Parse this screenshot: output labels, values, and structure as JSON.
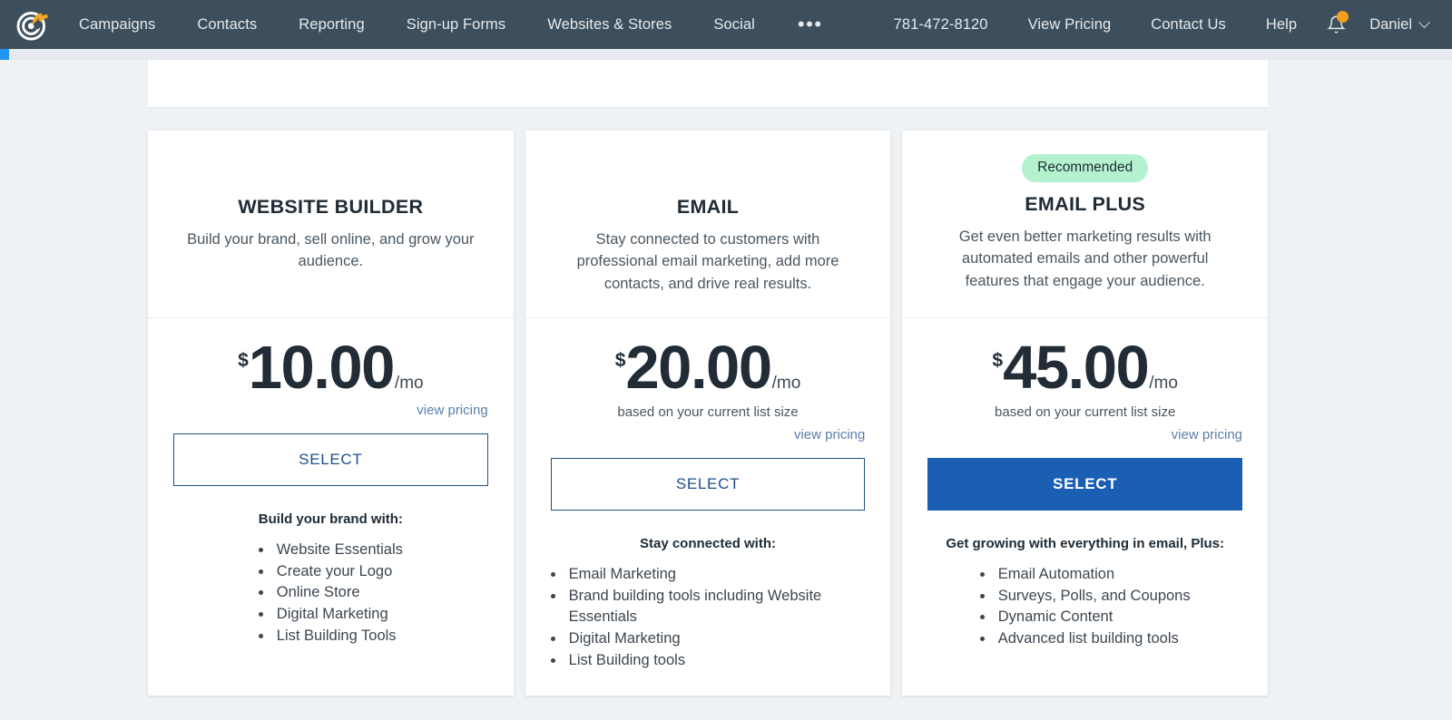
{
  "navbar": {
    "logo_icon": "constant-contact-spiral-logo",
    "left_links": [
      {
        "label": "Campaigns"
      },
      {
        "label": "Contacts"
      },
      {
        "label": "Reporting"
      },
      {
        "label": "Sign-up Forms"
      },
      {
        "label": "Websites & Stores"
      },
      {
        "label": "Social"
      }
    ],
    "overflow_label": "•••",
    "right_links": [
      {
        "label": "781-472-8120"
      },
      {
        "label": "View Pricing"
      },
      {
        "label": "Contact Us"
      },
      {
        "label": "Help"
      }
    ],
    "bell_icon": "notification-bell-icon",
    "has_notification": true,
    "user_name": "Daniel",
    "chevron_icon": "chevron-down-icon",
    "background_color": "#3d4f5c",
    "notification_color": "#f8a01c"
  },
  "progress": {
    "segment_color": "#2196f3",
    "track_color": "#e6eaee"
  },
  "plans": [
    {
      "badge": "",
      "name": "WEBSITE BUILDER",
      "description": "Build your brand, sell online, and grow your audience.",
      "currency": "$",
      "amount": "10.00",
      "period": "/mo",
      "list_note": "",
      "view_pricing": "view pricing",
      "select_label": "SELECT",
      "select_style": "outline",
      "features_title": "Build your brand with:",
      "features": [
        "Website Essentials",
        "Create your Logo",
        "Online Store",
        "Digital Marketing",
        "List Building Tools"
      ]
    },
    {
      "badge": "",
      "name": "EMAIL",
      "description": "Stay connected to customers with professional email marketing, add more contacts, and drive real results.",
      "currency": "$",
      "amount": "20.00",
      "period": "/mo",
      "list_note": "based on your current list size",
      "view_pricing": "view pricing",
      "select_label": "SELECT",
      "select_style": "outline",
      "features_title": "Stay connected with:",
      "features": [
        "Email Marketing",
        "Brand building tools including Website Essentials",
        "Digital Marketing",
        "List Building tools"
      ]
    },
    {
      "badge": "Recommended",
      "name": "EMAIL PLUS",
      "description": "Get even better marketing results with automated emails and other powerful features that engage your audience.",
      "currency": "$",
      "amount": "45.00",
      "period": "/mo",
      "list_note": "based on your current list size",
      "view_pricing": "view pricing",
      "select_label": "SELECT",
      "select_style": "primary",
      "features_title": "Get growing with everything in email, Plus:",
      "features": [
        "Email Automation",
        "Surveys, Polls, and Coupons",
        "Dynamic Content",
        "Advanced list building tools"
      ]
    }
  ],
  "colors": {
    "badge_bg": "#b4f2cf",
    "primary_button": "#1a5fb4",
    "link": "#5b7fae",
    "page_bg": "#eef2f5"
  }
}
